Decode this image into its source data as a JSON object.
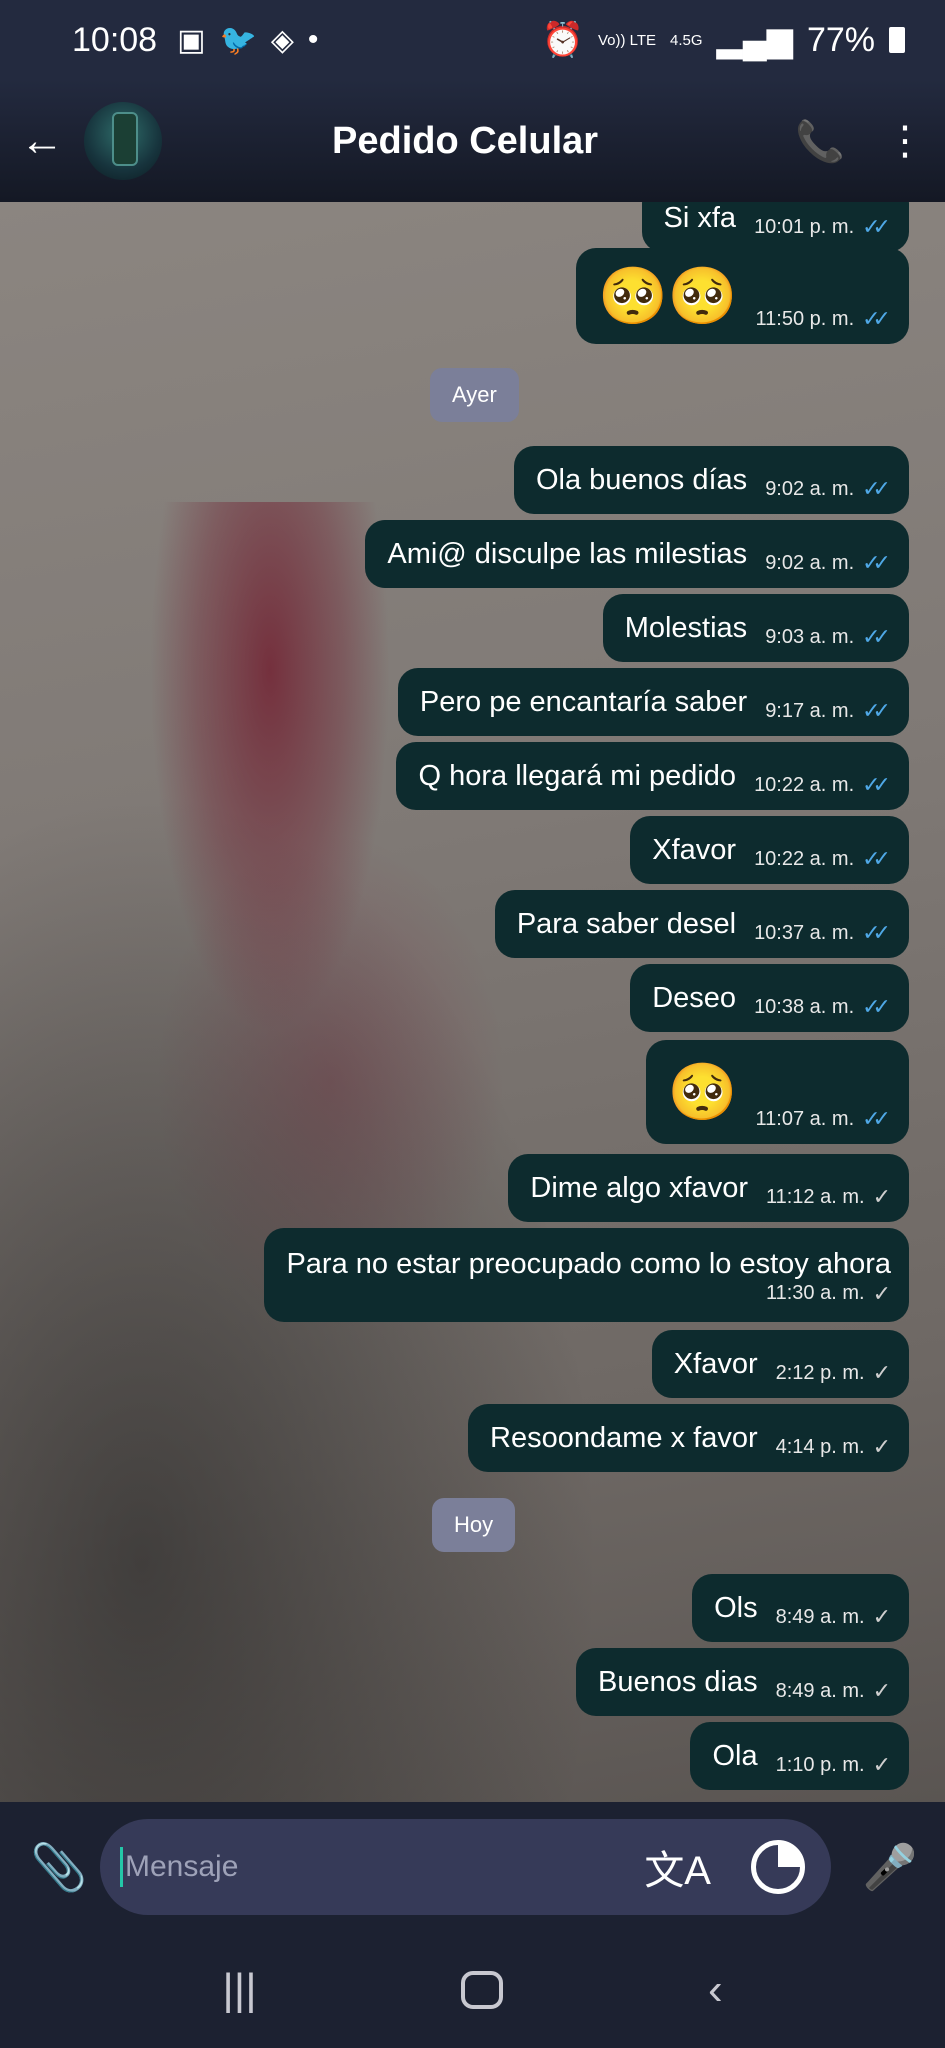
{
  "status_bar": {
    "time": "10:08",
    "left_icons": [
      "image-icon",
      "twitter-icon",
      "app-icon"
    ],
    "network_top": "Vo)) LTE",
    "network_speed": "4.5G",
    "battery": "77%"
  },
  "header": {
    "title": "Pedido Celular"
  },
  "dividers": {
    "yesterday": "Ayer",
    "today": "Hoy"
  },
  "messages": [
    {
      "text": "Si xfa",
      "time": "10:01 p. m.",
      "read": true
    },
    {
      "text": "🥺🥺",
      "time": "11:50 p. m.",
      "read": true
    },
    {
      "text": "Ola buenos días",
      "time": "9:02 a. m.",
      "read": true
    },
    {
      "text": "Ami@ disculpe las milestias",
      "time": "9:02 a. m.",
      "read": true
    },
    {
      "text": "Molestias",
      "time": "9:03 a. m.",
      "read": true
    },
    {
      "text": "Pero pe encantaría saber",
      "time": "9:17 a. m.",
      "read": true
    },
    {
      "text": "Q hora llegará mi pedido",
      "time": "10:22 a. m.",
      "read": true
    },
    {
      "text": "Xfavor",
      "time": "10:22 a. m.",
      "read": true
    },
    {
      "text": "Para saber desel",
      "time": "10:37 a. m.",
      "read": true
    },
    {
      "text": "Deseo",
      "time": "10:38 a. m.",
      "read": true
    },
    {
      "text": "🥺",
      "time": "11:07 a. m.",
      "read": true
    },
    {
      "text": "Dime algo xfavor",
      "time": "11:12 a. m.",
      "read": false
    },
    {
      "text": "Para no estar preocupado como lo estoy ahora",
      "time": "11:30 a. m.",
      "read": false
    },
    {
      "text": "Xfavor",
      "time": "2:12 p. m.",
      "read": false
    },
    {
      "text": "Resoondame x favor",
      "time": "4:14 p. m.",
      "read": false
    },
    {
      "text": "Ols",
      "time": "8:49 a. m.",
      "read": false
    },
    {
      "text": "Buenos dias",
      "time": "8:49 a. m.",
      "read": false
    },
    {
      "text": "Ola",
      "time": "1:10 p. m.",
      "read": false
    }
  ],
  "input": {
    "placeholder": "Mensaje"
  },
  "colors": {
    "bubble": "#0d2b2e",
    "read_tick": "#4fa8e6",
    "cursor": "#24c7a8"
  }
}
